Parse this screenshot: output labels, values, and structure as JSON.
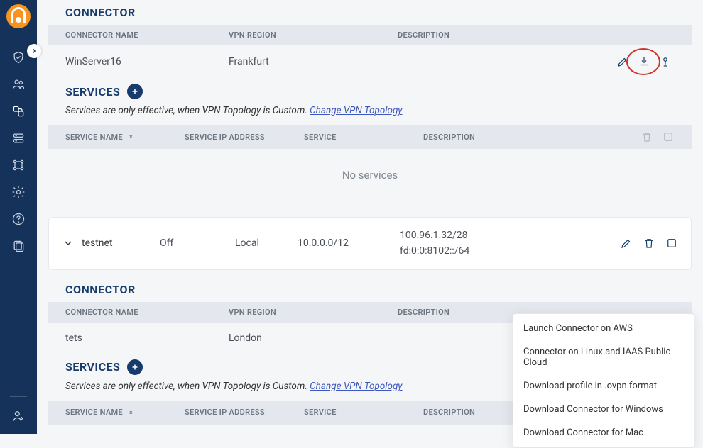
{
  "sections": {
    "connector1": {
      "title": "CONNECTOR",
      "headers": {
        "name": "Connector Name",
        "region": "VPN Region",
        "desc": "Description"
      },
      "row": {
        "name": "WinServer16",
        "region": "Frankfurt",
        "desc": ""
      }
    },
    "services1": {
      "title": "SERVICES",
      "hint_pre": "Services are only effective, when VPN Topology is Custom. ",
      "hint_link": "Change VPN Topology",
      "headers": {
        "name": "Service Name",
        "ip": "Service IP Address",
        "svc": "Service",
        "desc": "Description"
      },
      "empty": "No services"
    },
    "network_card": {
      "name": "testnet",
      "status": "Off",
      "location": "Local",
      "cidr": "10.0.0.0/12",
      "addr_v4": "100.96.1.32/28",
      "addr_v6": "fd:0:0:8102::/64"
    },
    "connector2": {
      "title": "CONNECTOR",
      "headers": {
        "name": "Connector Name",
        "region": "VPN Region",
        "desc": "Description"
      },
      "row": {
        "name": "tets",
        "region": "London",
        "desc": ""
      }
    },
    "services2": {
      "title": "SERVICES",
      "hint_pre": "Services are only effective, when VPN Topology is Custom. ",
      "hint_link": "Change VPN Topology",
      "headers": {
        "name": "Service Name",
        "ip": "Service IP Address",
        "svc": "Service",
        "desc": "Description"
      }
    }
  },
  "menu": {
    "items": {
      "0": "Launch Connector on AWS",
      "1": "Connector on Linux and IAAS Public Cloud",
      "2": "Download profile in .ovpn format",
      "3": "Download Connector for Windows",
      "4": "Download Connector for Mac"
    }
  }
}
